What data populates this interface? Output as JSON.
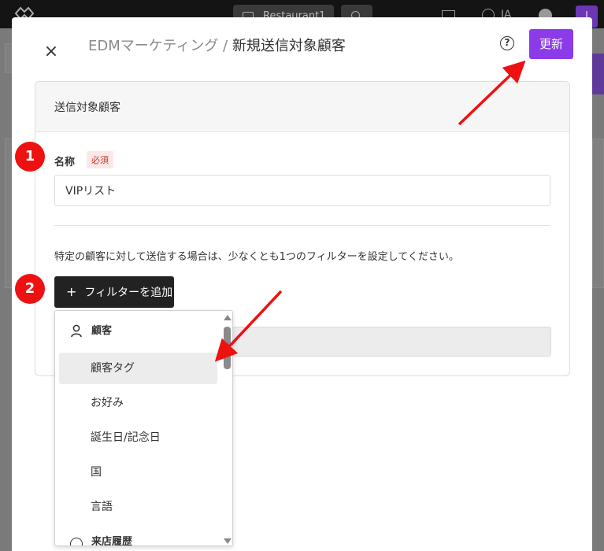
{
  "topbar": {
    "store_name": "Restaurant1",
    "language": "JA",
    "avatar_initial": "I"
  },
  "modal": {
    "breadcrumb": "EDMマーケティング",
    "separator": " / ",
    "title": "新規送信対象顧客",
    "update_label": "更新",
    "close_symbol": "×",
    "help_symbol": "?"
  },
  "section": {
    "heading": "送信対象顧客",
    "name_label": "名称",
    "required_label": "必須",
    "name_value": "VIPリスト",
    "hint": "特定の顧客に対して送信する場合は、少なくとも1つのフィルターを設定してください。",
    "add_filter_label": "フィルターを追加",
    "add_filter_symbol": "+"
  },
  "dropdown": {
    "group_customer": "顧客",
    "items": [
      "顧客タグ",
      "お好み",
      "誕生日/記念日",
      "国",
      "言語"
    ],
    "group_visit": "来店履歴"
  },
  "annotations": {
    "step1": "1",
    "step2": "2",
    "color": "#ee1111"
  },
  "colors": {
    "accent": "#8b3be8",
    "dark_button": "#222222",
    "required_bg": "#fde7e7",
    "required_text": "#c0392b"
  }
}
